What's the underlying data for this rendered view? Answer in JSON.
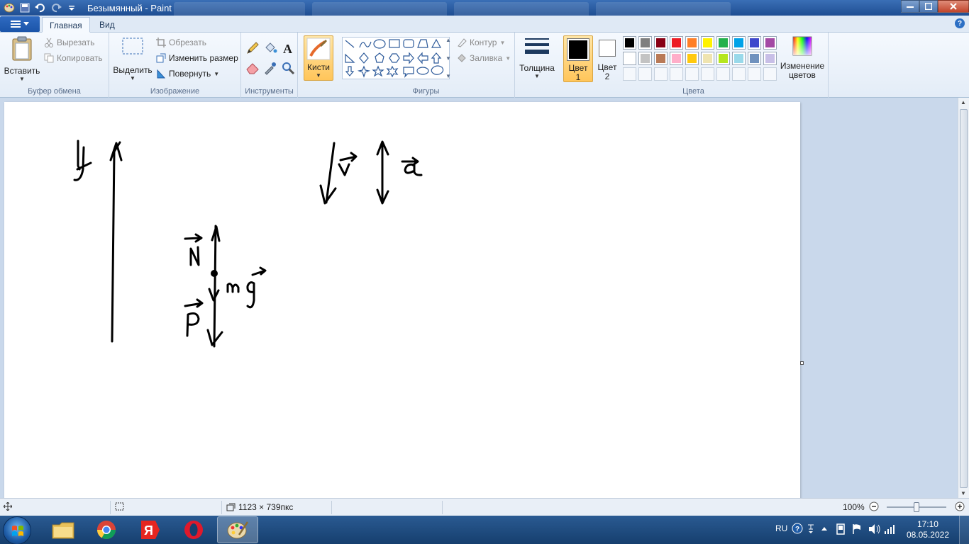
{
  "window": {
    "title": "Безымянный - Paint"
  },
  "tabs": {
    "file_label": "",
    "home": "Главная",
    "view": "Вид"
  },
  "ribbon": {
    "clipboard": {
      "group": "Буфер обмена",
      "paste": "Вставить",
      "cut": "Вырезать",
      "copy": "Копировать"
    },
    "image": {
      "group": "Изображение",
      "select": "Выделить",
      "crop": "Обрезать",
      "resize": "Изменить размер",
      "rotate": "Повернуть"
    },
    "tools": {
      "group": "Инструменты"
    },
    "brushes": {
      "label": "Кисти"
    },
    "shapes": {
      "group": "Фигуры",
      "outline": "Контур",
      "fill": "Заливка"
    },
    "size": {
      "label": "Толщина"
    },
    "colors": {
      "group": "Цвета",
      "color1_line1": "Цвет",
      "color1_line2": "1",
      "color2_line1": "Цвет",
      "color2_line2": "2",
      "edit_line1": "Изменение",
      "edit_line2": "цветов",
      "color1_value": "#000000",
      "color2_value": "#ffffff",
      "palette_row1": [
        "#000000",
        "#7f7f7f",
        "#880015",
        "#ed1c24",
        "#ff7f27",
        "#fff200",
        "#22b14c",
        "#00a2e8",
        "#3f48cc",
        "#a349a4"
      ],
      "palette_row2": [
        "#ffffff",
        "#c3c3c3",
        "#b97a57",
        "#ffaec9",
        "#ffc90e",
        "#efe4b0",
        "#b5e61d",
        "#99d9ea",
        "#7092be",
        "#c8bfe7"
      ]
    }
  },
  "status": {
    "canvas_size": "1123 × 739пкс",
    "zoom": "100%"
  },
  "taskbar": {
    "language": "RU",
    "time": "17:10",
    "date": "08.05.2022",
    "opera_label": "O",
    "yandex_label": "Я"
  },
  "drawing": {
    "y_label": "y",
    "N_label": "N",
    "mg_label": "mg",
    "P_label": "P",
    "v_label": "v",
    "a_label": "a"
  }
}
